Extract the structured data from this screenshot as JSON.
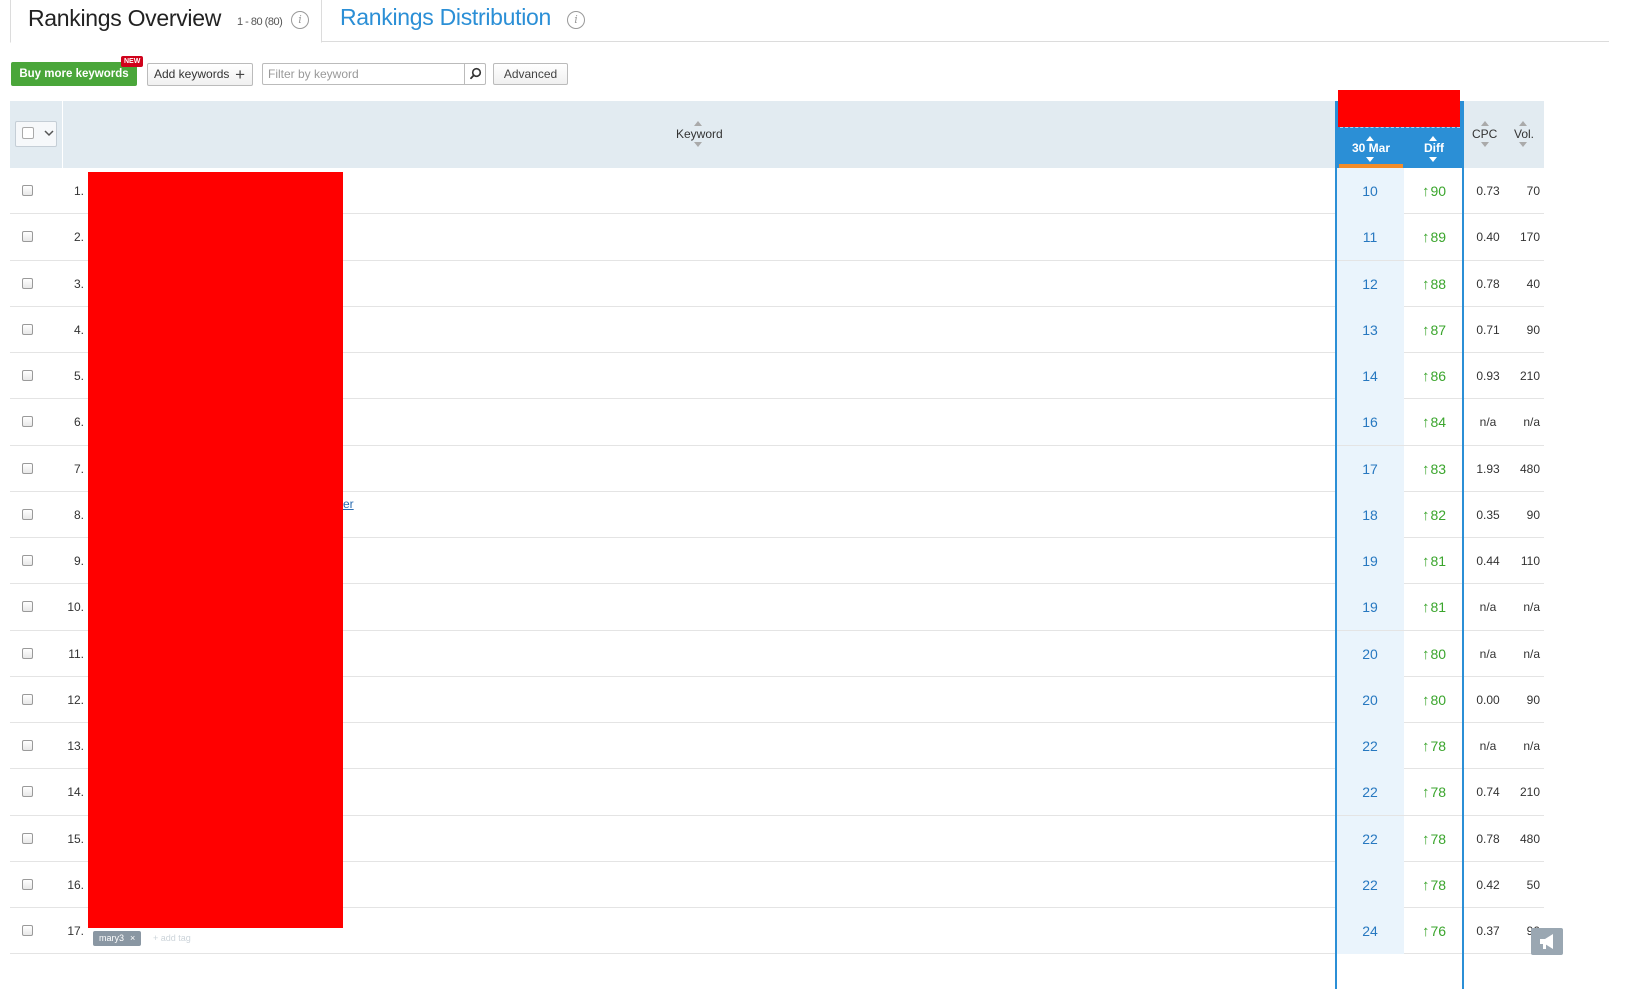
{
  "tabs": {
    "overview_title": "Rankings Overview",
    "overview_count": "1 - 80 (80)",
    "distribution_title": "Rankings Distribution",
    "info_glyph": "i"
  },
  "toolbar": {
    "buy_label": "Buy more keywords",
    "new_badge": "NEW",
    "add_label": "Add keywords",
    "add_glyph": "+",
    "filter_placeholder": "Filter by keyword",
    "advanced_label": "Advanced"
  },
  "table": {
    "header": {
      "keyword": "Keyword",
      "date": "30 Mar",
      "diff": "Diff",
      "cpc": "CPC",
      "vol": "Vol."
    },
    "rows": [
      {
        "num": "1.",
        "pos": "10",
        "diff": "90",
        "cpc": "0.73",
        "vol": "70"
      },
      {
        "num": "2.",
        "pos": "11",
        "diff": "89",
        "cpc": "0.40",
        "vol": "170"
      },
      {
        "num": "3.",
        "pos": "12",
        "diff": "88",
        "cpc": "0.78",
        "vol": "40"
      },
      {
        "num": "4.",
        "pos": "13",
        "diff": "87",
        "cpc": "0.71",
        "vol": "90"
      },
      {
        "num": "5.",
        "pos": "14",
        "diff": "86",
        "cpc": "0.93",
        "vol": "210"
      },
      {
        "num": "6.",
        "pos": "16",
        "diff": "84",
        "cpc": "n/a",
        "vol": "n/a"
      },
      {
        "num": "7.",
        "pos": "17",
        "diff": "83",
        "cpc": "1.93",
        "vol": "480"
      },
      {
        "num": "8.",
        "pos": "18",
        "diff": "82",
        "cpc": "0.35",
        "vol": "90"
      },
      {
        "num": "9.",
        "pos": "19",
        "diff": "81",
        "cpc": "0.44",
        "vol": "110"
      },
      {
        "num": "10.",
        "pos": "19",
        "diff": "81",
        "cpc": "n/a",
        "vol": "n/a"
      },
      {
        "num": "11.",
        "pos": "20",
        "diff": "80",
        "cpc": "n/a",
        "vol": "n/a"
      },
      {
        "num": "12.",
        "pos": "20",
        "diff": "80",
        "cpc": "0.00",
        "vol": "90"
      },
      {
        "num": "13.",
        "pos": "22",
        "diff": "78",
        "cpc": "n/a",
        "vol": "n/a"
      },
      {
        "num": "14.",
        "pos": "22",
        "diff": "78",
        "cpc": "0.74",
        "vol": "210"
      },
      {
        "num": "15.",
        "pos": "22",
        "diff": "78",
        "cpc": "0.78",
        "vol": "480"
      },
      {
        "num": "16.",
        "pos": "22",
        "diff": "78",
        "cpc": "0.42",
        "vol": "50"
      },
      {
        "num": "17.",
        "pos": "24",
        "diff": "76",
        "cpc": "0.37",
        "vol": "90"
      }
    ],
    "diff_arrow": "↑",
    "keyword_fragment": "er",
    "tag_label": "mary3",
    "tag_remove": "×",
    "add_tag_label": "+ add tag"
  },
  "colors": {
    "accent_blue": "#2b8fd6",
    "buy_green": "#4aa63a",
    "diff_green": "#3aa52c",
    "redaction": "#ff0000"
  },
  "icons": {
    "search": "search-icon",
    "info": "info-icon",
    "feedback": "feedback-megaphone-icon"
  }
}
